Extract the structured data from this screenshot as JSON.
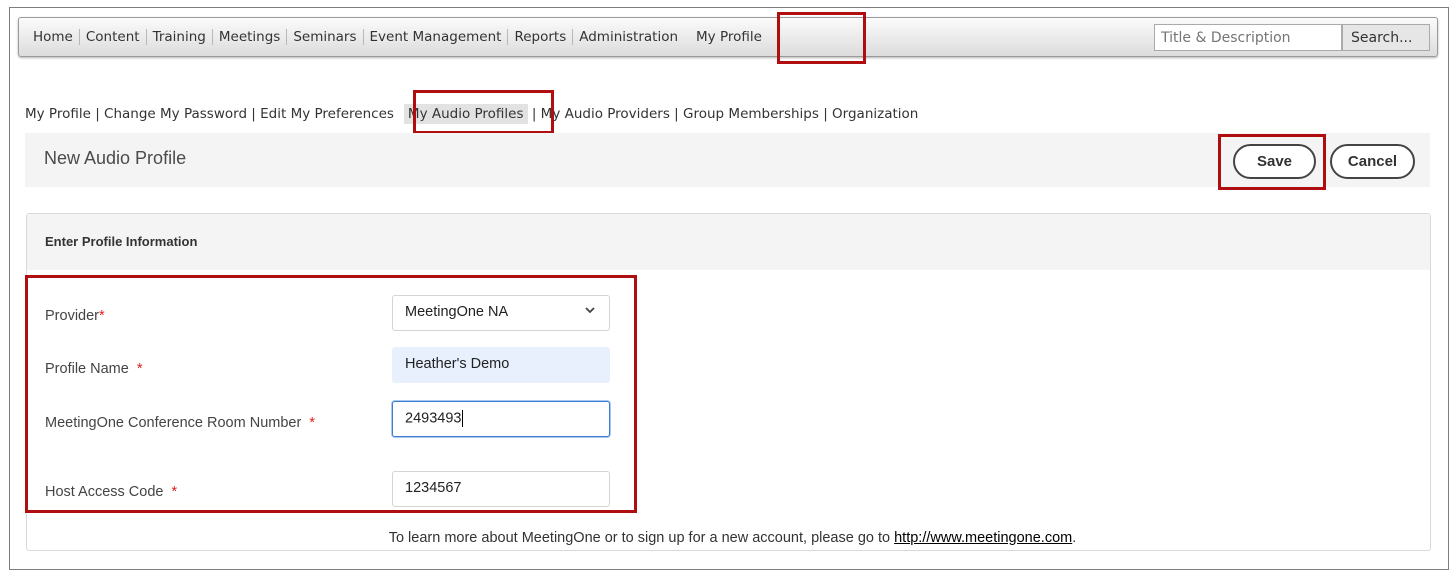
{
  "topnav": {
    "items": [
      "Home",
      "Content",
      "Training",
      "Meetings",
      "Seminars",
      "Event Management",
      "Reports",
      "Administration",
      "My Profile"
    ],
    "active": "My Profile",
    "search_placeholder": "Title & Description",
    "search_button": "Search..."
  },
  "subnav": {
    "items": [
      "My Profile",
      "Change My Password",
      "Edit My Preferences",
      "My Audio Profiles",
      "My Audio Providers",
      "Group Memberships",
      "Organization"
    ],
    "active": "My Audio Profiles",
    "separator": " | "
  },
  "header": {
    "title": "New Audio Profile",
    "save_label": "Save",
    "cancel_label": "Cancel"
  },
  "panel": {
    "title": "Enter Profile Information"
  },
  "form": {
    "provider_label": "Provider",
    "provider_value": "MeetingOne NA",
    "profile_name_label": "Profile Name",
    "profile_name_value": "Heather's Demo",
    "room_number_label": "MeetingOne Conference Room Number",
    "room_number_value": "2493493",
    "host_code_label": "Host Access Code",
    "host_code_value": "1234567",
    "required_mark": "*"
  },
  "footer": {
    "text": "To learn more about MeetingOne or to sign up for a new account, please go to ",
    "link": "http://www.meetingone.com",
    "suffix": "."
  },
  "colors": {
    "highlight_box": "#b00d10",
    "required": "#e02020",
    "autofill": "#e8f0fe",
    "focus": "#3b7fd4"
  }
}
